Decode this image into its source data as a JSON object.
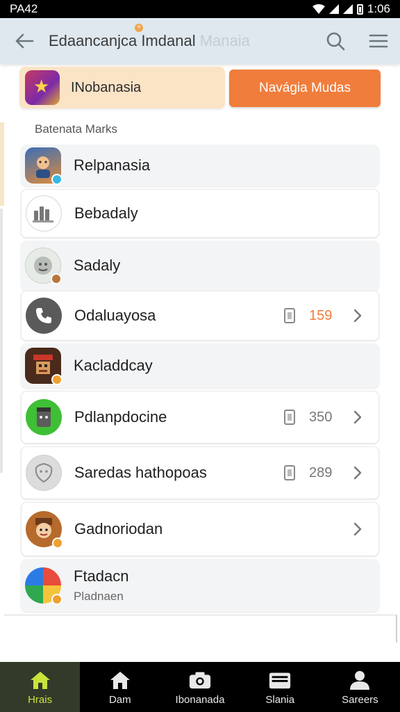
{
  "status_bar": {
    "left_text": "PA42",
    "time": "1:06"
  },
  "app_bar": {
    "title_main": "Edaancanjca Imdanal",
    "title_faded": " Manaia",
    "back_icon": "arrow-left-icon",
    "search_icon": "search-icon",
    "menu_icon": "hamburger-menu-icon"
  },
  "featured": {
    "label": "INobanasia",
    "button_label": "Navágia Mudas",
    "button_color": "#f07d3c"
  },
  "section_title": "Batenata Marks",
  "list": [
    {
      "label": "Relpanasia",
      "icon": "game-avatar-icon",
      "variant": "grey"
    },
    {
      "label": "Bebadaly",
      "icon": "bars-icon",
      "variant": "white"
    },
    {
      "label": "Sadaly",
      "icon": "face-emoji-icon",
      "variant": "grey"
    },
    {
      "label": "Odaluayosa",
      "icon": "phone-icon",
      "variant": "white",
      "count": "159",
      "count_accent": true,
      "chevron": true
    },
    {
      "label": "Kacladdcay",
      "icon": "pixel-game-icon",
      "variant": "grey"
    },
    {
      "label": "Pdlanpdocine",
      "icon": "green-robot-icon",
      "variant": "white",
      "count": "350",
      "chevron": true
    },
    {
      "label": "Saredas hathopoas",
      "icon": "shield-face-icon",
      "variant": "white",
      "count": "289",
      "chevron": true
    },
    {
      "label": "Gadnoriodan",
      "icon": "character-face-icon",
      "variant": "white",
      "chevron": true
    },
    {
      "label": "Ftadacn",
      "sub": "Pladnaen",
      "icon": "colorful-ball-icon",
      "variant": "grey"
    }
  ],
  "bottom_nav": [
    {
      "label": "Hrais",
      "icon": "home-icon",
      "active": true
    },
    {
      "label": "Dam",
      "icon": "house-icon"
    },
    {
      "label": "Ibonanada",
      "icon": "camera-icon"
    },
    {
      "label": "Slania",
      "icon": "folder-icon"
    },
    {
      "label": "Sareers",
      "icon": "person-icon"
    }
  ]
}
